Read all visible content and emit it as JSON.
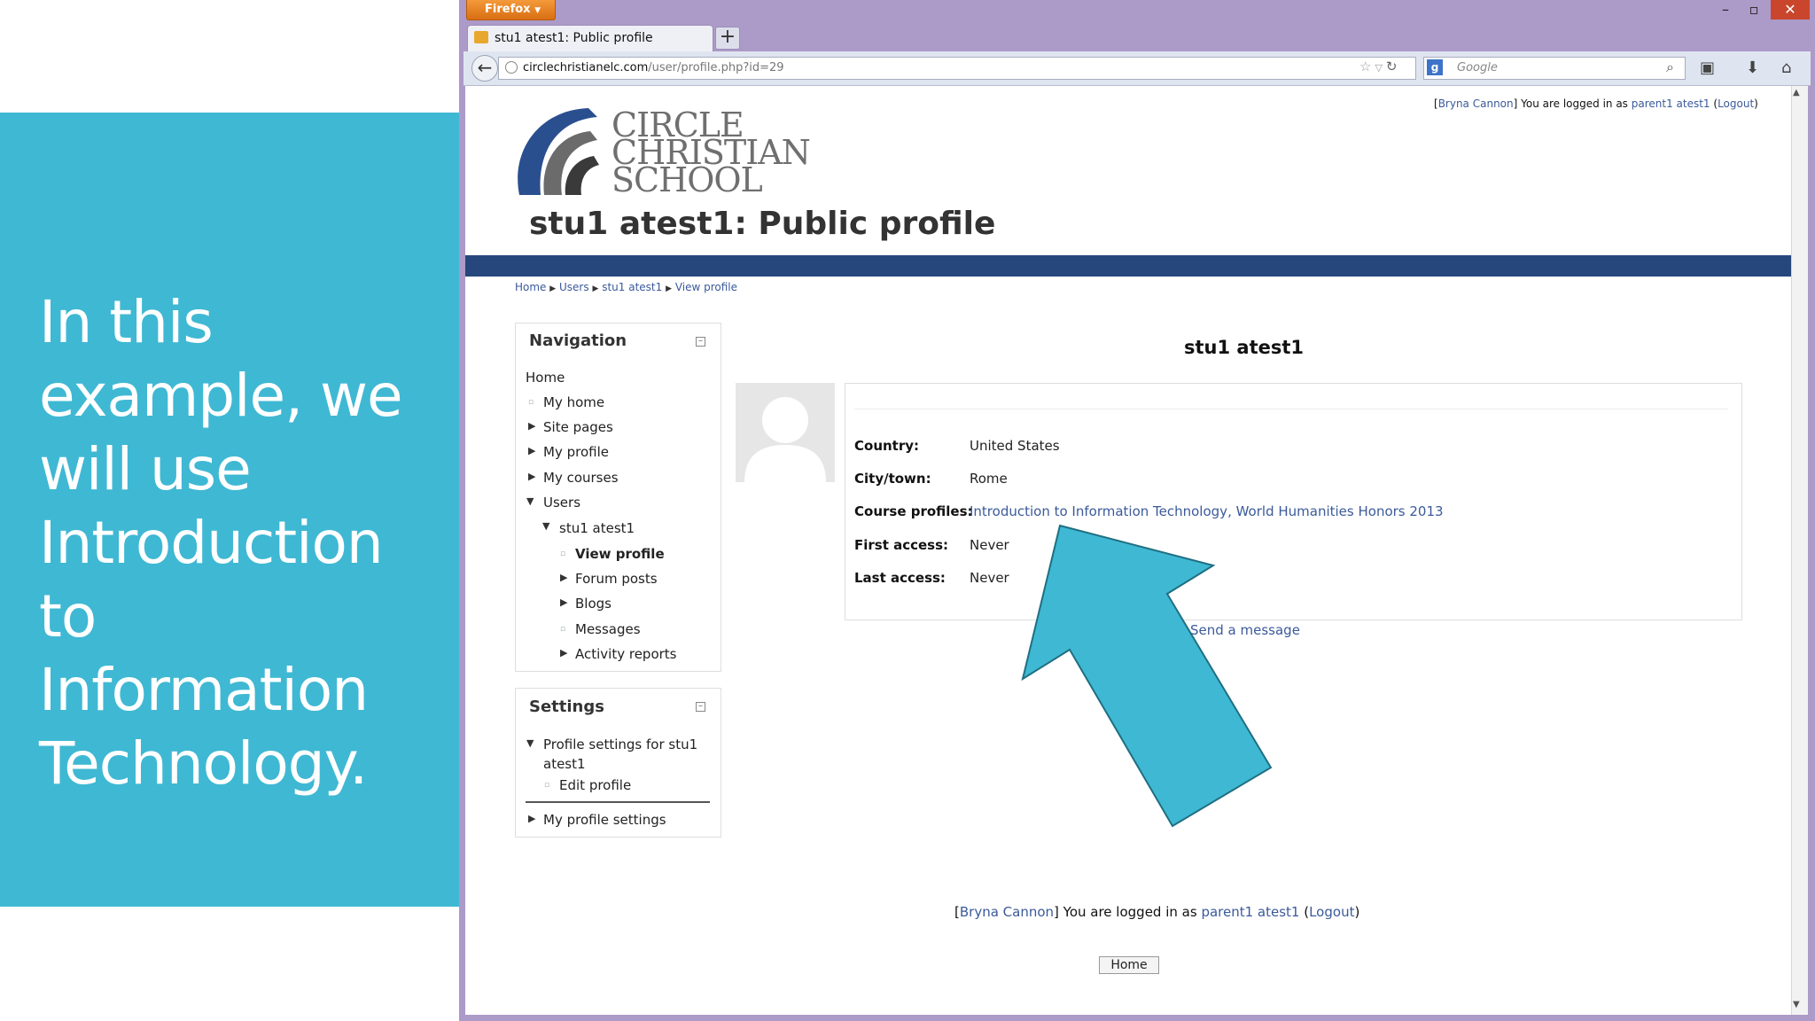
{
  "slide": {
    "text_lines": [
      "In this",
      "example, we",
      "will use",
      "Introduction to",
      "Information",
      "Technology."
    ]
  },
  "browser": {
    "menu_button": "Firefox",
    "tab_title": "stu1 atest1: Public profile",
    "new_tab": "+",
    "url_host": "circlechristianelc.com",
    "url_path": "/user/profile.php?id=29",
    "search_placeholder": "Google",
    "search_engine_icon": "g"
  },
  "header": {
    "login_prefix": "[",
    "login_user": "Bryna Cannon",
    "login_middle": "] You are logged in as ",
    "login_as": "parent1 atest1",
    "login_open": " (",
    "logout": "Logout",
    "login_close": ")",
    "logo_lines": [
      "CIRCLE",
      "CHRISTIAN",
      "SCHOOL"
    ],
    "page_title": "stu1 atest1: Public profile"
  },
  "breadcrumb": {
    "items": [
      "Home",
      "Users",
      "stu1 atest1",
      "View profile"
    ],
    "separator": "▶"
  },
  "navigation": {
    "title": "Navigation",
    "home": "Home",
    "my_home": "My home",
    "site_pages": "Site pages",
    "my_profile": "My profile",
    "my_courses": "My courses",
    "users": "Users",
    "user": "stu1 atest1",
    "view_profile": "View profile",
    "forum_posts": "Forum posts",
    "blogs": "Blogs",
    "messages": "Messages",
    "activity_reports": "Activity reports"
  },
  "settings": {
    "title": "Settings",
    "profile_settings_line1": "Profile settings for stu1",
    "profile_settings_line2": "atest1",
    "edit_profile": "Edit profile",
    "my_profile_settings": "My profile settings"
  },
  "profile": {
    "name": "stu1 atest1",
    "country_label": "Country:",
    "country": "United States",
    "city_label": "City/town:",
    "city": "Rome",
    "courses_label": "Course profiles:",
    "course1": "Introduction to Information Technology",
    "course_sep": ", ",
    "course2": "World Humanities Honors 2013",
    "first_access_label": "First access:",
    "first_access": "Never",
    "last_access_label": "Last access:",
    "last_access": "Never",
    "send_message": "Send a message"
  },
  "footer": {
    "home_button": "Home"
  },
  "colors": {
    "slide_accent": "#3fb8d3",
    "arrow": "#3fb8d3",
    "band": "#26477c",
    "link": "#3b5a9a",
    "window_frame": "#ac9ac8"
  }
}
